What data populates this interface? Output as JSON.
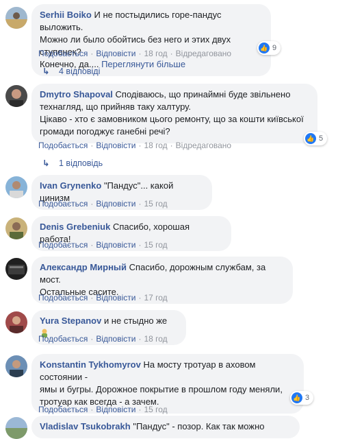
{
  "comments": [
    {
      "author": "Serhii Boiko",
      "text_lines": [
        "И не постыдились горе-пандус выложить.",
        "Можно ли было обойтись без него и этих двух ступенек?",
        "Конечно, да...."
      ],
      "more_link": "Переглянути більше",
      "actions": {
        "like": "Подобається",
        "reply": "Відповісти",
        "time": "18 год",
        "edited": "Відредаговано"
      },
      "reactions": "9",
      "replies": "4 відповіді"
    },
    {
      "author": "Dmytro Shapoval",
      "text_lines": [
        "Сподіваюсь, що принаймні буде звільнено",
        "технагляд, що прийняв таку халтуру.",
        "Цікаво - хто є замовником цього ремонту, що за кошти київської",
        "громади погоджує ганебні речі?"
      ],
      "actions": {
        "like": "Подобається",
        "reply": "Відповісти",
        "time": "18 год",
        "edited": "Відредаговано"
      },
      "reactions": "5",
      "replies": "1 відповідь"
    },
    {
      "author": "Ivan Grynenko",
      "text_lines": [
        "\"Пандус\"... какой цинизм"
      ],
      "actions": {
        "like": "Подобається",
        "reply": "Відповісти",
        "time": "15 год"
      }
    },
    {
      "author": "Denis Grebeniuk",
      "text_lines": [
        "Спасибо, хорошая работа!"
      ],
      "actions": {
        "like": "Подобається",
        "reply": "Відповісти",
        "time": "15 год"
      }
    },
    {
      "author": "Александр Мирный",
      "text_lines": [
        "Спасибо, дорожным службам, за мост.",
        "Остальные сасите."
      ],
      "actions": {
        "like": "Подобається",
        "reply": "Відповісти",
        "time": "17 год"
      }
    },
    {
      "author": "Yura Stepanov",
      "text_lines": [
        "и не стыдно же"
      ],
      "emoji": "person-facepalm-emoji",
      "actions": {
        "like": "Подобається",
        "reply": "Відповісти",
        "time": "18 год"
      }
    },
    {
      "author": "Konstantin Tykhomyrov",
      "text_lines": [
        "На мосту тротуар в аховом состоянии -",
        "ямы и бугры. Дорожное покрытие в прошлом году меняли,",
        "тротуар как всегда - а зачем."
      ],
      "actions": {
        "like": "Подобається",
        "reply": "Відповісти",
        "time": "15 год"
      },
      "reactions": "3"
    },
    {
      "author": "Vladislav Tsukobrakh",
      "text_lines": [
        "\"Пандус\" - позор. Как так можно"
      ]
    }
  ],
  "colors": {
    "link": "#385898",
    "meta": "#90949c",
    "bubble": "#f2f3f5",
    "like": "#2078f4"
  },
  "icons": {
    "reply_arrow": "reply-arrow-icon",
    "like": "thumbs-up-icon"
  }
}
